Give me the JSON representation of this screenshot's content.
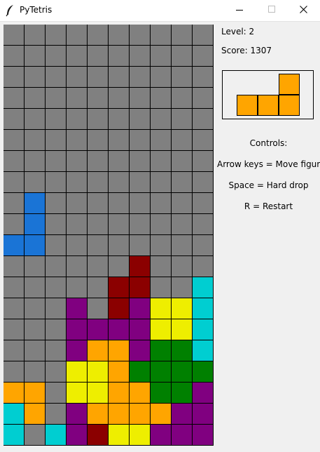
{
  "window": {
    "title": "PyTetris"
  },
  "sidebar": {
    "level_text": "Level: 2",
    "score_text": "Score: 1307",
    "controls_title": "Controls:",
    "controls": [
      "Arrow keys = Move figure",
      "Space = Hard drop",
      "R = Restart"
    ]
  },
  "colors": {
    "empty": "#808080",
    "grid_line": "#000000",
    "legend": {
      "B": "#1a74d6",
      "R": "#8b0000",
      "C": "#00ced1",
      "P": "#800080",
      "Y": "#eeee00",
      "O": "#ffa500",
      "G": "#008000"
    }
  },
  "board": {
    "columns": 10,
    "rows": [
      "..........",
      "..........",
      "..........",
      "..........",
      "..........",
      "..........",
      "..........",
      "..........",
      ".B........",
      ".B........",
      "BB........",
      "......R...",
      ".....RR..C",
      "...P.RPYYC",
      "...PPPPYYC",
      "...POOPGGC",
      "...YYOGGGG",
      "OO.YYOOGGP",
      "CO.POOOOPP",
      "C.CPRYYPPP"
    ]
  },
  "next_piece": {
    "name": "L",
    "color": "#ffa500",
    "shape": [
      "..X",
      "XXX"
    ]
  }
}
